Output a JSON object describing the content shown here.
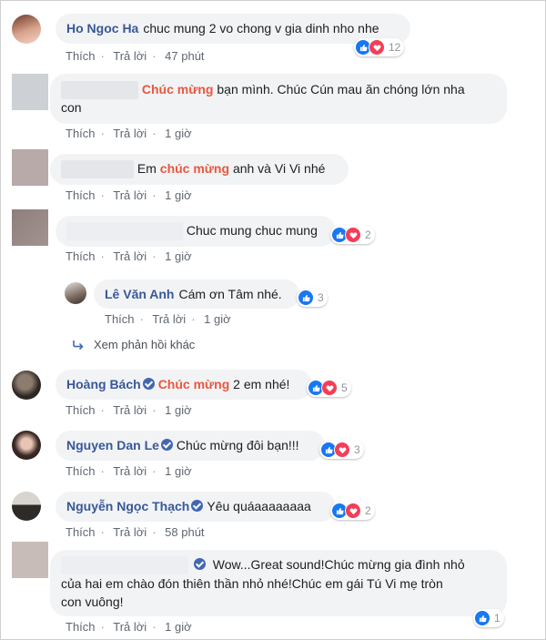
{
  "actions": {
    "like": "Thích",
    "reply": "Trả lời",
    "dot": "·"
  },
  "comments": [
    {
      "name": "Ho Ngoc Ha",
      "text": "chuc mung 2 vo chong v gia dinh nho nhe",
      "time": "47 phút",
      "reactions": "12"
    },
    {
      "highlight": "Chúc mừng",
      "text": "bạn mình. Chúc Cún mau ăn chóng lớn nha",
      "text2": "con",
      "time": "1 giờ"
    },
    {
      "prefix": "Em",
      "highlight": "chúc mừng",
      "text": "anh và Vi Vi nhé",
      "time": "1 giờ"
    },
    {
      "text": "Chuc mung chuc mung",
      "time": "1 giờ",
      "reactions": "2"
    },
    {
      "name": "Lê Văn Anh",
      "text": "Cám ơn Tâm nhé.",
      "time": "1 giờ",
      "reactions": "3"
    },
    {
      "name": "Hoàng Bách",
      "highlight": "Chúc mừng",
      "text": "2 em nhé!",
      "time": "1 giờ",
      "reactions": "5"
    },
    {
      "name": "Nguyen Dan Le",
      "text": "Chúc mừng đôi bạn!!!",
      "time": "1 giờ",
      "reactions": "3"
    },
    {
      "name": "Nguyễn Ngọc Thạch",
      "text": "Yêu quáaaaaaaaa",
      "time": "58 phút",
      "reactions": "2"
    },
    {
      "text": "Wow...Great sound!Chúc mừng gia đình nhỏ",
      "text2": "của hai em chào đón thiên thần nhỏ nhé!Chúc em gái Tú Vi mẹ tròn",
      "text3": "con vuông!",
      "time": "1 giờ",
      "reactions": "1"
    }
  ],
  "more_replies": "Xem phản hồi khác",
  "colors": {
    "link": "#385898",
    "highlight": "#e9573f",
    "like": "#1877f2",
    "love": "#f33e58",
    "bubble": "#f2f3f5"
  },
  "icons": [
    "like-icon",
    "love-icon",
    "verified-icon",
    "reply-arrow-icon"
  ]
}
